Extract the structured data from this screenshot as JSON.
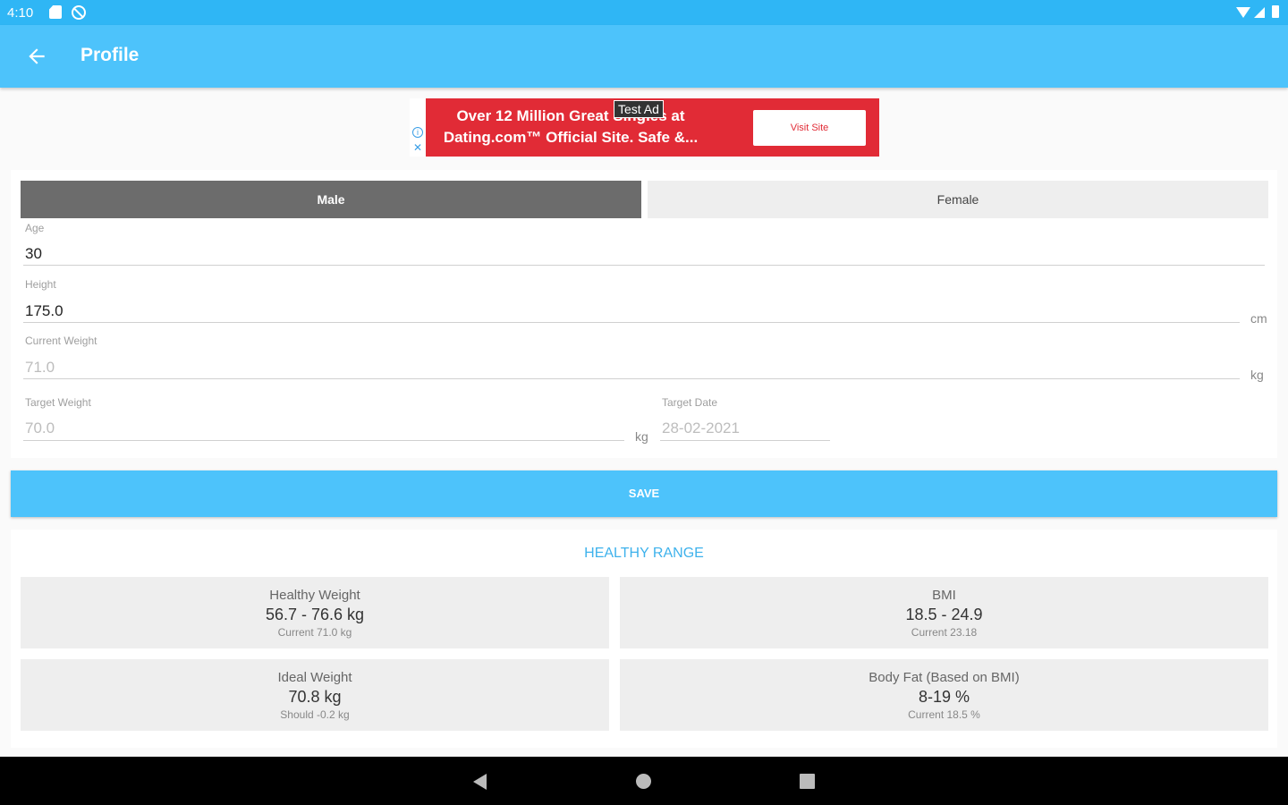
{
  "status_bar": {
    "time": "4:10"
  },
  "app_bar": {
    "title": "Profile"
  },
  "ad": {
    "line1": "Over 12 Million Great Singles at",
    "line2": "Dating.com™ Official Site. Safe &...",
    "badge": "Test Ad",
    "cta": "Visit Site",
    "adchoices_i": "i",
    "adchoices_x": "✕"
  },
  "gender": {
    "male": "Male",
    "female": "Female",
    "selected": "Male"
  },
  "fields": {
    "age": {
      "label": "Age",
      "value": "30"
    },
    "height": {
      "label": "Height",
      "value": "175.0",
      "unit": "cm"
    },
    "current_weight": {
      "label": "Current Weight",
      "value": "71.0",
      "unit": "kg"
    },
    "target_weight": {
      "label": "Target Weight",
      "value": "70.0",
      "unit": "kg"
    },
    "target_date": {
      "label": "Target Date",
      "value": "28-02-2021"
    }
  },
  "save_label": "SAVE",
  "healthy_range": {
    "title": "HEALTHY RANGE",
    "tiles": [
      {
        "label": "Healthy Weight",
        "value": "56.7 - 76.6 kg",
        "sub": "Current 71.0 kg"
      },
      {
        "label": "BMI",
        "value": "18.5 - 24.9",
        "sub": "Current 23.18"
      },
      {
        "label": "Ideal Weight",
        "value": "70.8 kg",
        "sub": "Should -0.2 kg"
      },
      {
        "label": "Body Fat (Based on BMI)",
        "value": "8-19 %",
        "sub": "Current 18.5 %"
      }
    ]
  },
  "colors": {
    "primary": "#4dc3fb",
    "status": "#2fb6f5",
    "accent_text": "#3eb2ec",
    "ad_red": "#e12b36",
    "selected_segment": "#6c6c6c"
  }
}
